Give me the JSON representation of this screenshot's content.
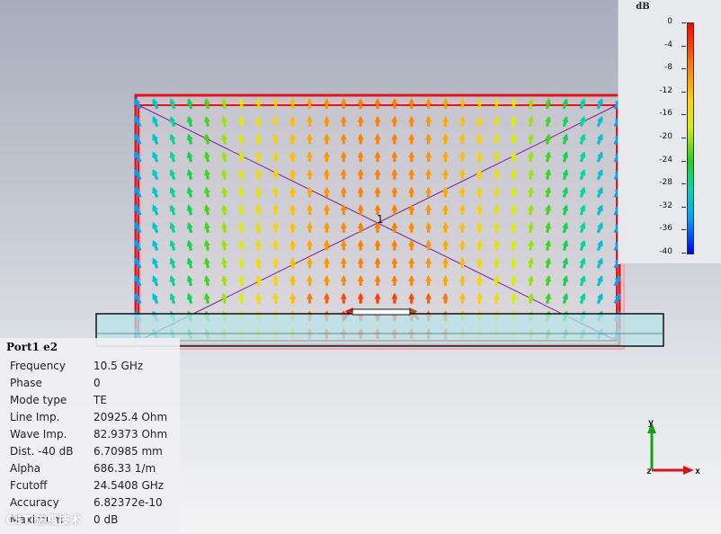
{
  "legend": {
    "unit": "dB",
    "ticks": [
      "0",
      "-4",
      "-8",
      "-12",
      "-16",
      "-20",
      "-24",
      "-28",
      "-32",
      "-36",
      "-40"
    ],
    "colors": [
      "#ff0000",
      "#ff7a00",
      "#ffd000",
      "#d8f000",
      "#20d020",
      "#00d8b0",
      "#00a0ff",
      "#0000ff"
    ]
  },
  "port_label": "1",
  "info": {
    "title": "Port1 e2",
    "rows": [
      {
        "key": "Frequency",
        "value": "10.5 GHz"
      },
      {
        "key": "Phase",
        "value": "0"
      },
      {
        "key": "Mode type",
        "value": "TE"
      },
      {
        "key": "Line Imp.",
        "value": "20925.4 Ohm"
      },
      {
        "key": "Wave Imp.",
        "value": "82.9373 Ohm"
      },
      {
        "key": "Dist. -40 dB",
        "value": "6.70985 mm"
      },
      {
        "key": "Alpha",
        "value": "686.33 1/m"
      },
      {
        "key": "Fcutoff",
        "value": "24.5408 GHz"
      },
      {
        "key": "Accuracy",
        "value": "6.82372e-10"
      },
      {
        "key": "Maximum",
        "value": "0 dB"
      }
    ]
  },
  "axes": {
    "y": "y",
    "z": "z",
    "x": "x"
  },
  "watermark": "CST 仿真技术",
  "colors": {
    "port_outline": "#e8121a",
    "substrate_fill": "#b8e4e8",
    "substrate_edge": "#111111",
    "diagonals": "#7a1d8c"
  }
}
